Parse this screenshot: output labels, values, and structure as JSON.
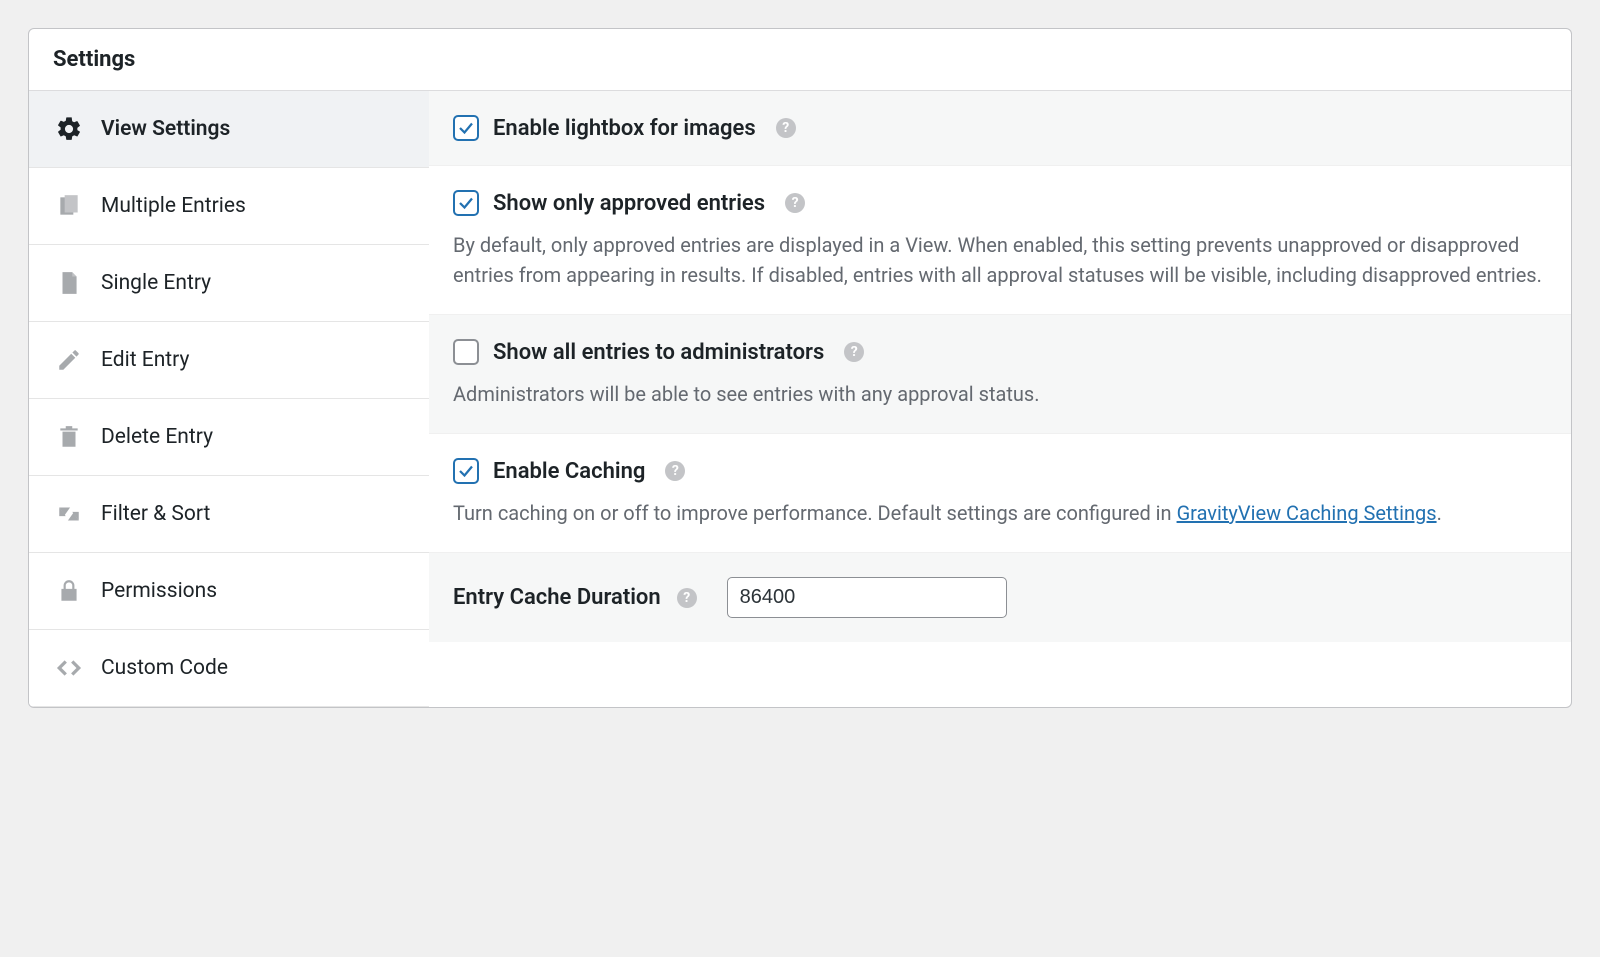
{
  "panel": {
    "title": "Settings"
  },
  "sidebar": {
    "items": [
      {
        "label": "View Settings",
        "icon": "gear"
      },
      {
        "label": "Multiple Entries",
        "icon": "copies"
      },
      {
        "label": "Single Entry",
        "icon": "page"
      },
      {
        "label": "Edit Entry",
        "icon": "pencil"
      },
      {
        "label": "Delete Entry",
        "icon": "trash"
      },
      {
        "label": "Filter & Sort",
        "icon": "sort"
      },
      {
        "label": "Permissions",
        "icon": "lock"
      },
      {
        "label": "Custom Code",
        "icon": "code"
      }
    ]
  },
  "settings": {
    "lightbox": {
      "label": "Enable lightbox for images",
      "checked": true
    },
    "approved": {
      "label": "Show only approved entries",
      "checked": true,
      "desc": "By default, only approved entries are displayed in a View. When enabled, this setting prevents unapproved or disapproved entries from appearing in results. If disabled, entries with all approval statuses will be visible, including disapproved entries."
    },
    "show_all_admin": {
      "label": "Show all entries to administrators",
      "checked": false,
      "desc": "Administrators will be able to see entries with any approval status."
    },
    "caching": {
      "label": "Enable Caching",
      "checked": true,
      "desc_prefix": "Turn caching on or off to improve performance. Default settings are configured in ",
      "link_text": "GravityView Caching Settings",
      "desc_suffix": "."
    },
    "cache_duration": {
      "label": "Entry Cache Duration",
      "value": "86400"
    }
  }
}
